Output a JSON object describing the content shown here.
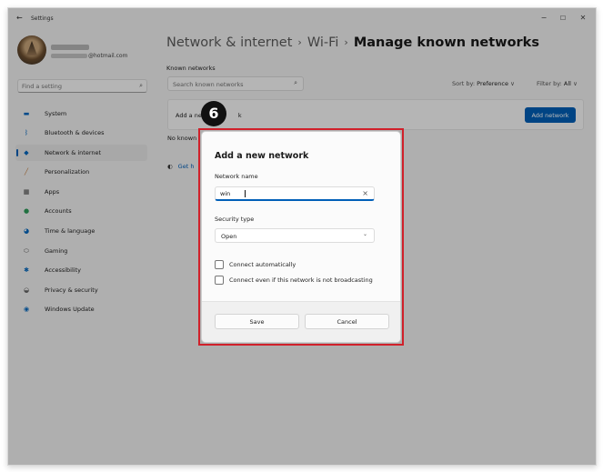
{
  "window": {
    "back_icon": "back-arrow-icon",
    "title": "Settings",
    "controls": [
      "minimize",
      "maximize",
      "close"
    ]
  },
  "account": {
    "email_suffix": "@hotmail.com"
  },
  "sidebar": {
    "search_placeholder": "Find a setting",
    "items": [
      {
        "label": "System",
        "icon": "monitor-icon",
        "color": "#0067c0"
      },
      {
        "label": "Bluetooth & devices",
        "icon": "bluetooth-icon",
        "color": "#0067c0"
      },
      {
        "label": "Network & internet",
        "icon": "wifi-icon",
        "color": "#0067c0",
        "active": true
      },
      {
        "label": "Personalization",
        "icon": "brush-icon",
        "color": "#c27a3a"
      },
      {
        "label": "Apps",
        "icon": "apps-icon",
        "color": "#444444"
      },
      {
        "label": "Accounts",
        "icon": "person-icon",
        "color": "#2e9d5a"
      },
      {
        "label": "Time & language",
        "icon": "globe-clock-icon",
        "color": "#0067c0"
      },
      {
        "label": "Gaming",
        "icon": "gamepad-icon",
        "color": "#666666"
      },
      {
        "label": "Accessibility",
        "icon": "accessibility-icon",
        "color": "#0067c0"
      },
      {
        "label": "Privacy & security",
        "icon": "shield-icon",
        "color": "#666666"
      },
      {
        "label": "Windows Update",
        "icon": "update-icon",
        "color": "#0067c0"
      }
    ]
  },
  "breadcrumb": {
    "part1": "Network & internet",
    "part2": "Wi-Fi",
    "current": "Manage known networks",
    "separator": "›"
  },
  "main": {
    "known_networks_label": "Known networks",
    "search_placeholder": "Search known networks",
    "sort_prefix": "Sort by: ",
    "sort_value": "Preference",
    "filter_prefix": "Filter by: ",
    "filter_value": "All",
    "add_card_label": "Add a ne",
    "add_card_label_tail": "k",
    "add_network_button": "Add network",
    "no_known_text": "No known",
    "get_help": "Get h"
  },
  "step_badge": "6",
  "dialog": {
    "title": "Add a new network",
    "network_name_label": "Network name",
    "network_name_value": "win",
    "security_type_label": "Security type",
    "security_type_value": "Open",
    "connect_auto_label": "Connect automatically",
    "connect_even_label": "Connect even if this network is not broadcasting",
    "save_label": "Save",
    "cancel_label": "Cancel"
  },
  "colors": {
    "accent": "#005fb8",
    "highlight_border": "#d0202a"
  }
}
